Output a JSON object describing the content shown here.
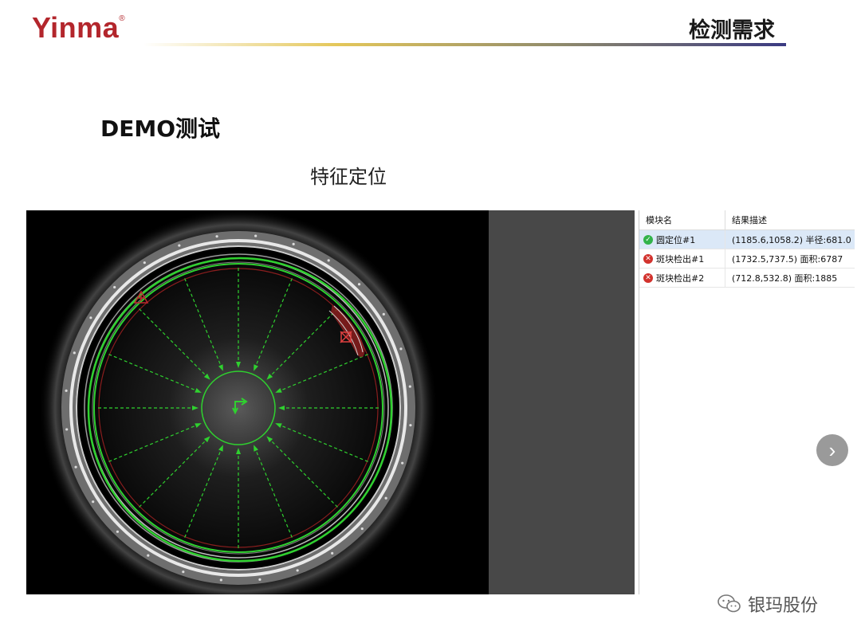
{
  "header": {
    "logo_text": "Yinma",
    "logo_mark": "®",
    "title": "检测需求"
  },
  "demo_title": "DEMO测试",
  "section_title": "特征定位",
  "results": {
    "columns": [
      "模块名",
      "结果描述"
    ],
    "rows": [
      {
        "status": "ok",
        "icon": "check-circle-icon",
        "name": "圆定位#1",
        "desc": "(1185.6,1058.2) 半径:681.0"
      },
      {
        "status": "ng",
        "icon": "error-circle-icon",
        "name": "斑块检出#1",
        "desc": "(1732.5,737.5) 面积:6787"
      },
      {
        "status": "ng",
        "icon": "error-circle-icon",
        "name": "斑块检出#2",
        "desc": "(712.8,532.8) 面积:1885"
      }
    ]
  },
  "next_button": {
    "icon": "chevron-right-icon",
    "glyph": "›"
  },
  "watermark": {
    "icon": "wechat-icon",
    "text": "银玛股份"
  },
  "colors": {
    "brand_red": "#b3262c",
    "detect_green": "#2fd12f",
    "defect_red": "#c0282d",
    "ok_green": "#32b34a",
    "ng_red": "#d2322d"
  }
}
